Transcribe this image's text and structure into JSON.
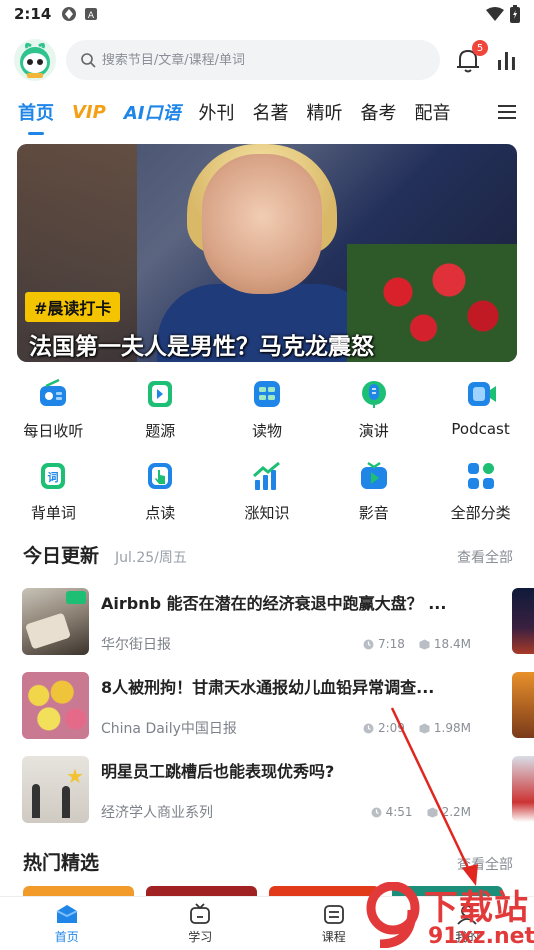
{
  "status": {
    "time": "2:14"
  },
  "header": {
    "search_placeholder": "搜索节目/文章/课程/单词",
    "notification_count": "5"
  },
  "tabs": [
    {
      "label": "首页"
    },
    {
      "label": "VIP"
    },
    {
      "label": "AI口语"
    },
    {
      "label": "外刊"
    },
    {
      "label": "名著"
    },
    {
      "label": "精听"
    },
    {
      "label": "备考"
    },
    {
      "label": "配音"
    }
  ],
  "banner": {
    "tag": "#晨读打卡",
    "headline": "法国第一夫人是男性？马克龙震怒"
  },
  "categories": [
    {
      "label": "每日收听",
      "icon": "radio-icon"
    },
    {
      "label": "题源",
      "icon": "question-bank-icon"
    },
    {
      "label": "读物",
      "icon": "reading-icon"
    },
    {
      "label": "演讲",
      "icon": "speech-icon"
    },
    {
      "label": "Podcast",
      "icon": "podcast-icon"
    },
    {
      "label": "背单词",
      "icon": "vocabulary-icon"
    },
    {
      "label": "点读",
      "icon": "tap-read-icon"
    },
    {
      "label": "涨知识",
      "icon": "knowledge-icon"
    },
    {
      "label": "影音",
      "icon": "video-icon"
    },
    {
      "label": "全部分类",
      "icon": "all-categories-icon"
    }
  ],
  "today": {
    "title": "今日更新",
    "date": "Jul.25/周五",
    "more": "查看全部",
    "items": [
      {
        "title": "Airbnb 能否在潜在的经济衰退中跑赢大盘？ ...",
        "source": "华尔街日报",
        "duration": "7:18",
        "size": "18.4M"
      },
      {
        "title": "8人被刑拘！甘肃天水通报幼儿血铅异常调查...",
        "source": "China Daily中国日报",
        "duration": "2:09",
        "size": "1.98M"
      },
      {
        "title": "明星员工跳槽后也能表现优秀吗?",
        "source": "经济学人商业系列",
        "duration": "4:51",
        "size": "2.2M"
      }
    ]
  },
  "hot": {
    "title": "热门精选",
    "more": "查看全部"
  },
  "bottom_nav": [
    {
      "label": "首页"
    },
    {
      "label": "学习"
    },
    {
      "label": "课程"
    },
    {
      "label": "我的"
    }
  ],
  "watermark": {
    "text": "下载站",
    "url": "91xz.net"
  },
  "colors": {
    "accent": "#1f86e8",
    "icon_green": "#1cbf73",
    "vip": "#f4a017",
    "badge": "#f0463c"
  }
}
